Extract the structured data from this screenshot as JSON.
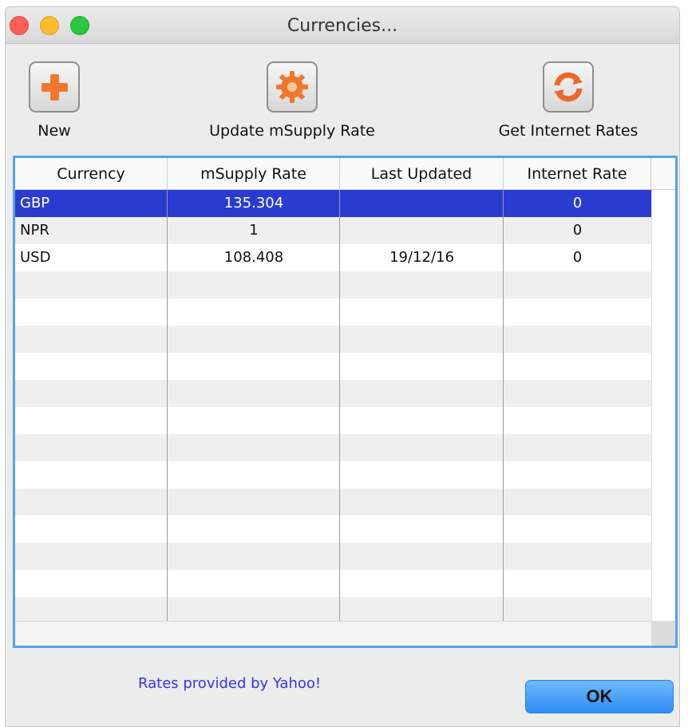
{
  "window": {
    "title": "Currencies..."
  },
  "toolbar": {
    "new_label": "New",
    "update_label": "Update mSupply Rate",
    "internet_label": "Get Internet Rates"
  },
  "table": {
    "columns": [
      "Currency",
      "mSupply Rate",
      "Last Updated",
      "Internet Rate"
    ],
    "rows": [
      {
        "currency": "GBP",
        "msupply_rate": "135.304",
        "last_updated": "",
        "internet_rate": "0",
        "selected": true
      },
      {
        "currency": "NPR",
        "msupply_rate": "1",
        "last_updated": "",
        "internet_rate": "0",
        "selected": false
      },
      {
        "currency": "USD",
        "msupply_rate": "108.408",
        "last_updated": "19/12/16",
        "internet_rate": "0",
        "selected": false
      }
    ],
    "selection_color": "#2a3cd0",
    "border_color": "#5aa3e6"
  },
  "footer": {
    "credit": "Rates provided by Yahoo!",
    "ok_label": "OK"
  },
  "icons": {
    "new": "plus-icon",
    "update": "gear-icon",
    "internet": "refresh-icon"
  }
}
